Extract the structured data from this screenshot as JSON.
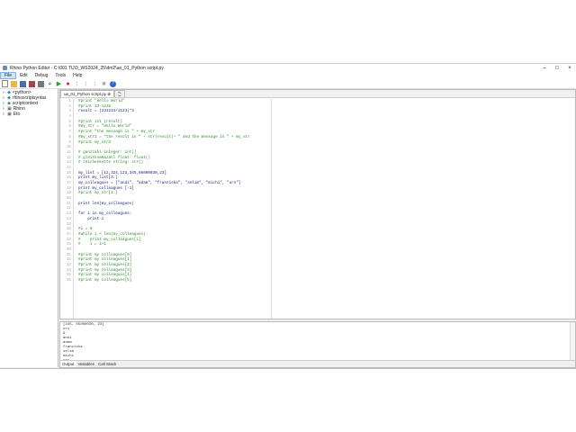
{
  "window": {
    "title": "Rhino Python Editor - C:\\001 TU\\3_WS2024_25\\dm2\\ue_01_Python script.py"
  },
  "menu": [
    "File",
    "Edit",
    "Debug",
    "Tools",
    "Help"
  ],
  "tree": [
    "<python>",
    "rhinoscriptsyntax",
    "scriptcontext",
    "Rhino",
    "Eto"
  ],
  "editor": {
    "tab": "ue_01_Python script.py",
    "lines": [
      {
        "t": "#print \"Hello World\"",
        "c": "c"
      },
      {
        "t": "#print 23-1235",
        "c": "c"
      },
      {
        "t": "result = (231234/1123)*3",
        "c": "k"
      },
      {
        "t": "",
        "c": "k"
      },
      {
        "t": "#print int (result)",
        "c": "c"
      },
      {
        "t": "#my_str = \"Hello World\"",
        "c": "c"
      },
      {
        "t": "#print \"the message is \" + my_str",
        "c": "c"
      },
      {
        "t": "#my_str2 = \"the result is \" + str(result)+ \" and the message is \" + my_str",
        "c": "c"
      },
      {
        "t": "#print my_str2",
        "c": "c"
      },
      {
        "t": "",
        "c": "k"
      },
      {
        "t": "# ganzzahl integer: int()",
        "c": "c"
      },
      {
        "t": "# gleitkommazahl float: float()",
        "c": "c"
      },
      {
        "t": "# zeichenkette string: str()",
        "c": "c"
      },
      {
        "t": "",
        "c": "k"
      },
      {
        "t": "my_list = [12,324,123,345,05000030,23]",
        "c": "k"
      },
      {
        "t": "print my_list[3:]",
        "c": "k"
      },
      {
        "t": "my_colleagues = [\"andi\", \"adam\", \"franziska\", \"selim\", \"michi\", \"urs\"]",
        "c": "k"
      },
      {
        "t": "print my_colleagues [-1]",
        "c": "k"
      },
      {
        "t": "#print my_str[1:]",
        "c": "c"
      },
      {
        "t": "",
        "c": "k"
      },
      {
        "t": "print len(my_colleagues)",
        "c": "k"
      },
      {
        "t": "",
        "c": "k"
      },
      {
        "t": "for i in my_colleagues:",
        "c": "k"
      },
      {
        "t": "    print i",
        "c": "k"
      },
      {
        "t": "",
        "c": "k"
      },
      {
        "t": "#i = 0",
        "c": "c"
      },
      {
        "t": "#while i < len(my_colleagues):",
        "c": "c"
      },
      {
        "t": "#    print my_colleagues[i]",
        "c": "c"
      },
      {
        "t": "#    i = i+1",
        "c": "c"
      },
      {
        "t": "",
        "c": "k"
      },
      {
        "t": "#print my colleagues[0]",
        "c": "c"
      },
      {
        "t": "#print my colleagues[1]",
        "c": "c"
      },
      {
        "t": "#print my colleagues[2]",
        "c": "c"
      },
      {
        "t": "#print my colleagues[3]",
        "c": "c"
      },
      {
        "t": "#print my colleagues[4]",
        "c": "c"
      },
      {
        "t": "#print my colleagues[5]",
        "c": "c"
      }
    ]
  },
  "output": {
    "lines": [
      "[345, 05000030, 23]",
      "urs",
      "6",
      "andi",
      "adam",
      "franziska",
      "selim",
      "michi",
      "urs"
    ],
    "tabs": [
      "Output",
      "Variables",
      "Call Stack"
    ]
  }
}
